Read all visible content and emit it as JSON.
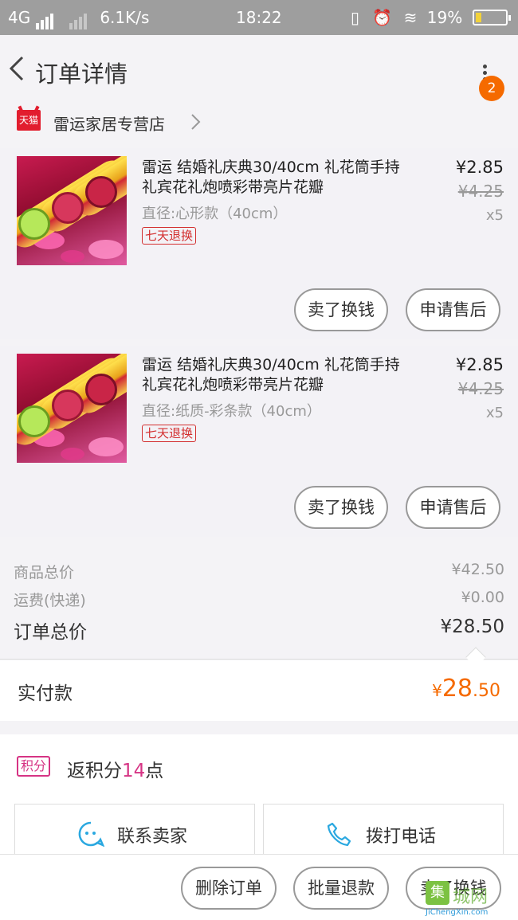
{
  "status_bar": {
    "network": "4G",
    "speed": "6.1K/s",
    "time": "18:22",
    "battery": "19%",
    "battery_level": 0.19
  },
  "header": {
    "title": "订单详情",
    "badge_count": "2"
  },
  "shop": {
    "platform_logo": "天猫",
    "name": "雷运家居专营店"
  },
  "items": [
    {
      "title": "雷运 结婚礼庆典30/40cm 礼花筒手持礼宾花礼炮喷彩带亮片花瓣",
      "spec": "直径:心形款（40cm）",
      "tag": "七天退换",
      "price": "¥2.85",
      "original_price": "¥4.25",
      "quantity": "x5",
      "sell_label": "卖了换钱",
      "after_sale_label": "申请售后"
    },
    {
      "title": "雷运 结婚礼庆典30/40cm 礼花筒手持礼宾花礼炮喷彩带亮片花瓣",
      "spec": "直径:纸质-彩条款（40cm）",
      "tag": "七天退换",
      "price": "¥2.85",
      "original_price": "¥4.25",
      "quantity": "x5",
      "sell_label": "卖了换钱",
      "after_sale_label": "申请售后"
    }
  ],
  "totals": {
    "goods_label": "商品总价",
    "goods_value": "¥42.50",
    "shipping_label": "运费(快递)",
    "shipping_value": "¥0.00",
    "order_label": "订单总价",
    "order_value": "¥28.50"
  },
  "paid": {
    "label": "实付款",
    "currency": "¥",
    "integer": "28",
    "decimal": ".50"
  },
  "points": {
    "tag": "积分",
    "prefix": "返积分",
    "count": "14",
    "suffix": "点"
  },
  "contact": {
    "seller_label": "联系卖家",
    "phone_label": "拨打电话"
  },
  "bottom_bar": {
    "delete_label": "删除订单",
    "batch_refund_label": "批量退款",
    "sell_label": "卖了换钱"
  },
  "watermark": {
    "box": "集",
    "text": "城网",
    "url": "JiChengXin.com"
  },
  "colors": {
    "accent": "#f56a00",
    "tmall_red": "#e21d2e",
    "points_pink": "#d63384",
    "tag_red": "#d32f2f"
  }
}
